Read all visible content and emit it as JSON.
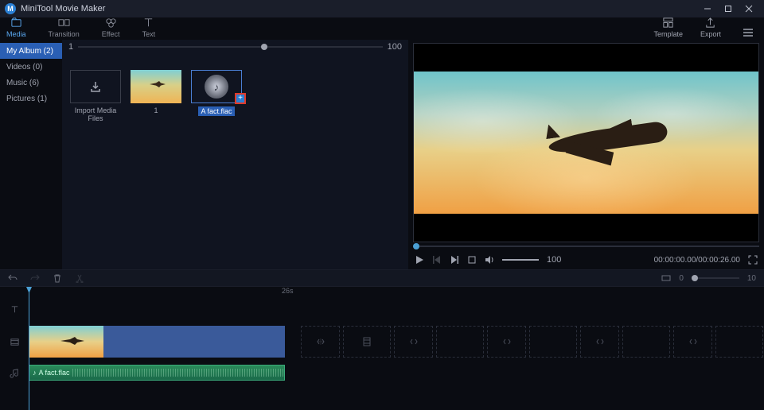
{
  "app": {
    "title": "MiniTool Movie Maker"
  },
  "toolbar": {
    "tabs": {
      "media": "Media",
      "transition": "Transition",
      "effect": "Effect",
      "text": "Text"
    },
    "template": "Template",
    "export": "Export"
  },
  "sidebar": {
    "my_album": "My Album (2)",
    "videos": "Videos (0)",
    "music": "Music (6)",
    "pictures": "Pictures (1)"
  },
  "album": {
    "zoom_min": "1",
    "zoom_max": "100",
    "import_label": "Import Media Files",
    "thumb1_label": "1",
    "thumb2_label": "A fact.flac"
  },
  "player": {
    "volume": "100",
    "timecode": "00:00:00.00/00:00:26.00"
  },
  "strip": {
    "tl_min": "0",
    "tl_max": "10"
  },
  "timeline": {
    "ruler_mark_1": "26s",
    "audio_clip_label": "A fact.flac"
  }
}
